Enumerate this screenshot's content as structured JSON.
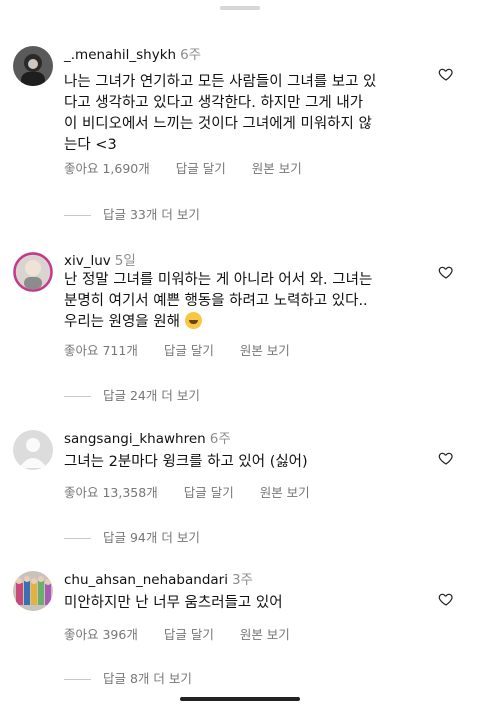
{
  "comments": [
    {
      "username": "_.menahil_shykh",
      "time": "6주",
      "text": "나는 그녀가 연기하고 모든 사람들이 그녀를 보고 있\n다고 생각하고 있다고 생각한다. 하지만 그게 내가\n이 비디오에서 느끼는 것이다 그녀에게 미워하지 않\n는다 <3",
      "likes": "좋아요 1,690개",
      "reply": "답글 달기",
      "original": "원본 보기",
      "more_replies": "답글 33개 더 보기"
    },
    {
      "username": "xiv_luv",
      "time": "5일",
      "text": "난 정말 그녀를 미워하는 게 아니라 어서 와. 그녀는\n분명히 여기서 예쁜 행동을 하려고 노력하고 있다..\n우리는 원영을 원해",
      "likes": "좋아요 711개",
      "reply": "답글 달기",
      "original": "원본 보기",
      "more_replies": "답글 24개 더 보기"
    },
    {
      "username": "sangsangi_khawhren",
      "time": "6주",
      "text": "그녀는 2분마다 윙크를 하고 있어 (싫어)",
      "likes": "좋아요 13,358개",
      "reply": "답글 달기",
      "original": "원본 보기",
      "more_replies": "답글 94개 더 보기"
    },
    {
      "username": "chu_ahsan_nehabandari",
      "time": "3주",
      "text": "미안하지만 난 너무 움츠러들고 있어",
      "likes": "좋아요 396개",
      "reply": "답글 달기",
      "original": "원본 보기",
      "more_replies": "답글 8개 더 보기"
    }
  ],
  "colors": {
    "secondary_text": "#777777",
    "primary_text": "#111111",
    "background": "#ffffff"
  },
  "icons": {
    "like": "heart-outline-icon",
    "emoji": "crying-face-emoji"
  }
}
